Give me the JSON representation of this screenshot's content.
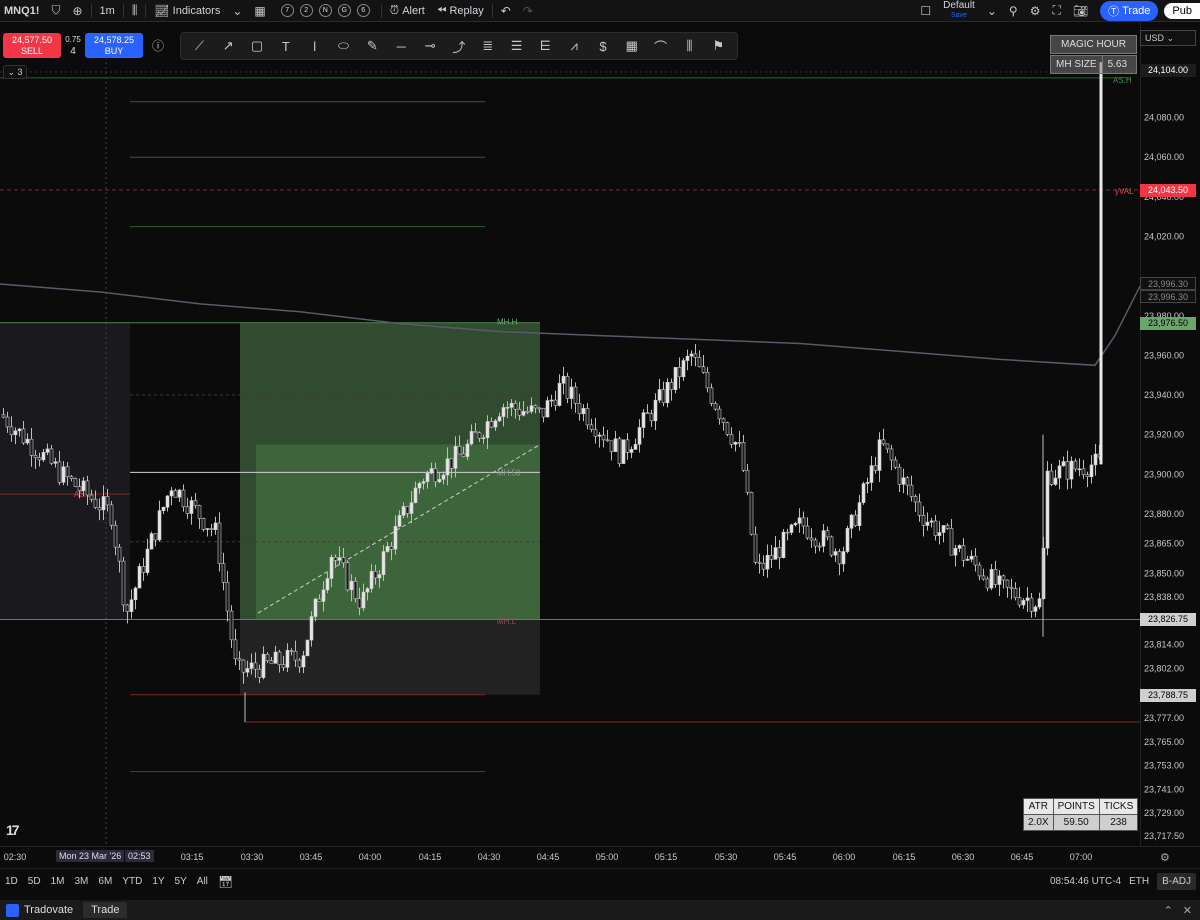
{
  "toolbar": {
    "symbol": "MNQ1!",
    "timeframe": "1m",
    "indicators_label": "Indicators",
    "layout_circles": [
      "7",
      "2",
      "N",
      "G",
      "6"
    ],
    "alert_label": "Alert",
    "replay_label": "Replay",
    "layout_name": "Default",
    "layout_sub": "Save",
    "trade_label": "Trade",
    "publish_label": "Pub"
  },
  "order": {
    "sell_price": "24,577.50",
    "sell_label": "SELL",
    "buy_price": "24,578.25",
    "buy_label": "BUY",
    "spread": "0.75",
    "qty": "4"
  },
  "currency": "USD",
  "collapse_label": "3",
  "magic_hour": {
    "title": "MAGIC HOUR",
    "size_label": "MH SIZE",
    "size_value": "5.63"
  },
  "price_axis": {
    "min": 23710,
    "max": 24110,
    "ticks": [
      "24,104.00",
      "24,080.00",
      "24,060.00",
      "24,040.00",
      "24,020.00",
      "23,980.00",
      "23,960.00",
      "23,940.00",
      "23,920.00",
      "23,900.00",
      "23,880.00",
      "23,865.00",
      "23,850.00",
      "23,838.00",
      "23,814.00",
      "23,802.00",
      "23,777.00",
      "23,765.00",
      "23,753.00",
      "23,741.00",
      "23,729.00",
      "23,717.50"
    ],
    "labels": {
      "current": "24,104.00",
      "yval": "24,043.50",
      "ma1": "23,996.30",
      "ma2": "23,996.30",
      "mh_high": "23,976.50",
      "mh_low": "23,826.75",
      "low": "23,788.75"
    }
  },
  "levels": {
    "as_h": {
      "label": "AS.H",
      "value": 24100
    },
    "yval": {
      "label": "yVAL",
      "value": 24043.5
    },
    "as_l": {
      "label": "AS.L",
      "value": 23890
    },
    "mh_h": {
      "label": "MH.H",
      "value": 23976.5
    },
    "mh_50": {
      "label": "MH.50",
      "value": 23901
    },
    "mh_l": {
      "label": "MH.L",
      "value": 23826.75
    }
  },
  "atr_table": {
    "headers": [
      "ATR",
      "POINTS",
      "TICKS"
    ],
    "values": [
      "2.0X",
      "59.50",
      "238"
    ]
  },
  "time_axis": {
    "labels": [
      "02:30",
      "03:15",
      "03:30",
      "03:45",
      "04:00",
      "04:15",
      "04:30",
      "04:45",
      "05:00",
      "05:15",
      "05:30",
      "05:45",
      "06:00",
      "06:15",
      "06:30",
      "06:45",
      "07:00"
    ],
    "crosshair_date": "Mon 23 Mar '26",
    "crosshair_time": "02:53"
  },
  "bottom": {
    "ranges": [
      "1D",
      "5D",
      "1M",
      "3M",
      "6M",
      "YTD",
      "1Y",
      "5Y",
      "All"
    ],
    "clock": "08:54:46 UTC-4",
    "session": "ETH",
    "adj": "B-ADJ"
  },
  "footer": {
    "app": "Tradovate",
    "tab": "Trade"
  },
  "colors": {
    "green": "#4caf50",
    "red": "#f23645",
    "zone_green": "#3c6e3c",
    "candle": "#c8c8c8"
  }
}
